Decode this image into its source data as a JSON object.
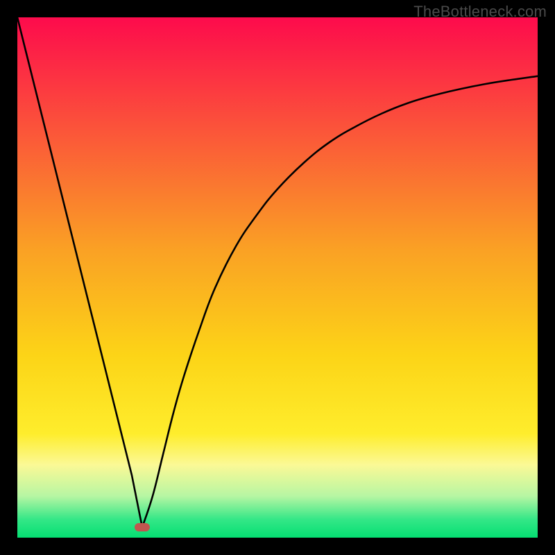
{
  "watermark": "TheBottleneck.com",
  "chart_data": {
    "type": "line",
    "title": "",
    "xlabel": "",
    "ylabel": "",
    "xlim": [
      0,
      100
    ],
    "ylim": [
      0,
      100
    ],
    "grid": false,
    "legend": false,
    "marker": {
      "x": 24,
      "y": 2,
      "color": "#c1564f"
    },
    "gradient_stops": [
      {
        "pos": 0.0,
        "color": "#fd0b4c"
      },
      {
        "pos": 0.2,
        "color": "#fb4f3b"
      },
      {
        "pos": 0.45,
        "color": "#faa224"
      },
      {
        "pos": 0.65,
        "color": "#fcd417"
      },
      {
        "pos": 0.8,
        "color": "#feed2c"
      },
      {
        "pos": 0.86,
        "color": "#fbf996"
      },
      {
        "pos": 0.92,
        "color": "#b7f6a3"
      },
      {
        "pos": 0.965,
        "color": "#34e787"
      },
      {
        "pos": 1.0,
        "color": "#05df72"
      }
    ],
    "series": [
      {
        "name": "curve",
        "x": [
          0,
          2,
          4,
          6,
          8,
          10,
          12,
          14,
          16,
          18,
          20,
          22,
          24,
          26,
          28,
          30,
          32,
          35,
          38,
          42,
          46,
          50,
          55,
          60,
          65,
          70,
          75,
          80,
          85,
          90,
          95,
          100
        ],
        "y": [
          100,
          92,
          84,
          76,
          68,
          60,
          52,
          44,
          36,
          28,
          20,
          12,
          2,
          8,
          16,
          24,
          31,
          40,
          48,
          56,
          62,
          67,
          72,
          76,
          79,
          81.5,
          83.5,
          85,
          86.2,
          87.2,
          88,
          88.7
        ]
      }
    ]
  }
}
